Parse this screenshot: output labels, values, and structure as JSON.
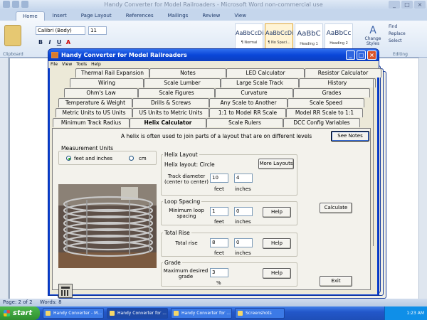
{
  "word": {
    "title": "Handy Converter for Model Railroaders - Microsoft Word non-commercial use",
    "tabs": [
      "Home",
      "Insert",
      "Page Layout",
      "References",
      "Mailings",
      "Review",
      "View"
    ],
    "font_name": "Calibri (Body)",
    "font_size": "11",
    "styles": [
      {
        "sample": "AaBbCcDi",
        "label": "¶ Normal"
      },
      {
        "sample": "AaBbCcDi",
        "label": "¶ No Spaci..."
      },
      {
        "sample": "AaBbC",
        "label": "Heading 1"
      },
      {
        "sample": "AaBbCc",
        "label": "Heading 2"
      }
    ],
    "change_styles": "Change Styles",
    "editing": [
      "Find",
      "Replace",
      "Select"
    ],
    "groups": [
      "Clipboard",
      "Editing"
    ],
    "status": [
      "Page: 2 of 2",
      "Words: 8"
    ]
  },
  "taskbar": {
    "start": "start",
    "tasks": [
      "Handy Converter - M...",
      "Handy Converter for ...",
      "Handy Converter for ...",
      "Screenshots"
    ],
    "clock": "1:23 AM"
  },
  "app": {
    "title": "Handy Converter for Model Railroaders",
    "menu": [
      "File",
      "View",
      "Tools",
      "Help"
    ],
    "tab_rows": [
      [
        "Thermal Rail Expansion",
        "Notes",
        "LED Calculator",
        "Resistor Calculator"
      ],
      [
        "Wiring",
        "Scale Lumber",
        "Large Scale Track",
        "History"
      ],
      [
        "Ohm's Law",
        "Scale Figures",
        "Curvature",
        "Grades"
      ],
      [
        "Temperature & Weight",
        "Drills & Screws",
        "Any Scale to Another",
        "Scale Speed"
      ],
      [
        "Metric Units to US Units",
        "US Units to Metric Units",
        "1:1 to Model RR Scale",
        "Model RR Scale to 1:1"
      ],
      [
        "Minimum Track Radius",
        "Helix Calculator",
        "Scale Rulers",
        "DCC Config Variables"
      ]
    ],
    "active_tab": "Helix Calculator",
    "help_text": "A helix is often used to join parts of a layout that are on different levels",
    "see_notes": "See Notes",
    "measurement": {
      "title": "Measurement Units",
      "options": [
        "feet and inches",
        "cm"
      ],
      "selected": "feet and inches"
    },
    "helix_layout": {
      "title": "Helix Layout",
      "layout_label": "Helix layout: Circle",
      "more_layouts": "More Layouts",
      "diameter_label": "Track diameter (center to center)",
      "feet": "10",
      "inches": "4"
    },
    "loop_spacing": {
      "title": "Loop Spacing",
      "label": "Minimum loop spacing",
      "feet": "1",
      "inches": "0"
    },
    "total_rise": {
      "title": "Total Rise",
      "label": "Total rise",
      "feet": "8",
      "inches": "0"
    },
    "grade": {
      "title": "Grade",
      "label": "Maximum desired grade",
      "value": "3",
      "unit": "%"
    },
    "units": {
      "feet": "feet",
      "inches": "inches"
    },
    "help_button": "Help",
    "calculate": "Calculate",
    "exit": "Exit"
  }
}
